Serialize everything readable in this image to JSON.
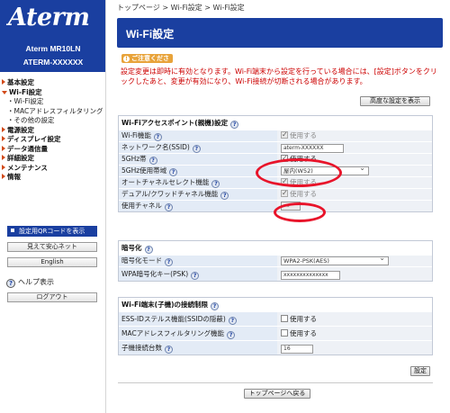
{
  "sidebar": {
    "brand": "Aterm",
    "model": "Aterm   MR10LN",
    "device_name": "ATERM-XXXXXX",
    "menu": [
      {
        "type": "sec",
        "label": "基本設定",
        "open": false
      },
      {
        "type": "sec",
        "label": "Wi-Fi設定",
        "open": true
      },
      {
        "type": "sub",
        "label": "Wi-Fi設定"
      },
      {
        "type": "sub",
        "label": "MACアドレスフィルタリング"
      },
      {
        "type": "sub",
        "label": "その他の設定"
      },
      {
        "type": "sec",
        "label": "電源設定",
        "open": false
      },
      {
        "type": "sec",
        "label": "ディスプレイ設定",
        "open": false
      },
      {
        "type": "sec",
        "label": "データ通信量",
        "open": false
      },
      {
        "type": "sec",
        "label": "詳細設定",
        "open": false
      },
      {
        "type": "sec",
        "label": "メンテナンス",
        "open": false
      },
      {
        "type": "sec",
        "label": "情報",
        "open": false
      }
    ],
    "qr_button": "設定用QRコードを表示",
    "mieru_button": "見えて安心ネット",
    "english_button": "English",
    "help_label": "ヘルプ表示",
    "logout_button": "ログアウト"
  },
  "breadcrumb": "トップページ > Wi-Fi設定 > Wi-Fi設定",
  "page_title": "Wi-Fi設定",
  "notice_badge": "ご注意ください",
  "notice_text": "設定変更は即時に有効となります。Wi-Fi端末から設定を行っている場合には、[設定]ボタンをクリックしたあと、変更が有効になり、Wi-Fi接続が切断される場合があります。",
  "advanced_button": "高度な設定を表示",
  "ap_section": {
    "title": "Wi-Fiアクセスポイント(親機)設定",
    "rows": {
      "wifi_func_label": "Wi-Fi機能",
      "wifi_func_value": "使用する",
      "ssid_label": "ネットワーク名(SSID)",
      "ssid_value": "aterm-XXXXXX",
      "ghz5_label": "5GHz帯",
      "ghz5_value": "使用する",
      "ghz5_band_label": "5GHz使用帯域",
      "ghz5_band_value": "屋内(W52)",
      "auto_ch_label": "オートチャネルセレクト機能",
      "auto_ch_value": "使用する",
      "dual_label": "デュアル/クワッドチャネル機能",
      "dual_value": "使用する",
      "channel_label": "使用チャネル",
      "channel_value": "—"
    }
  },
  "enc_section": {
    "title": "暗号化",
    "mode_label": "暗号化モード",
    "mode_value": "WPA2-PSK(AES)",
    "key_label": "WPA暗号化キー(PSK)",
    "key_value": "xxxxxxxxxxxxxx"
  },
  "limit_section": {
    "title": "Wi-Fi端末(子機)の接続制限",
    "stealth_label": "ESS-IDステルス機能(SSIDの隠蔽)",
    "stealth_value": "使用する",
    "mac_label": "MACアドレスフィルタリング機能",
    "mac_value": "使用する",
    "count_label": "子機接続台数",
    "count_value": "16"
  },
  "set_button": "設定",
  "back_button": "トップページへ戻る",
  "help_glyph": "?",
  "colors": {
    "brand_blue": "#1a3fa0",
    "notice_red": "#cc0000",
    "highlight_red": "#e8142a",
    "badge_orange": "#e8a33a"
  }
}
